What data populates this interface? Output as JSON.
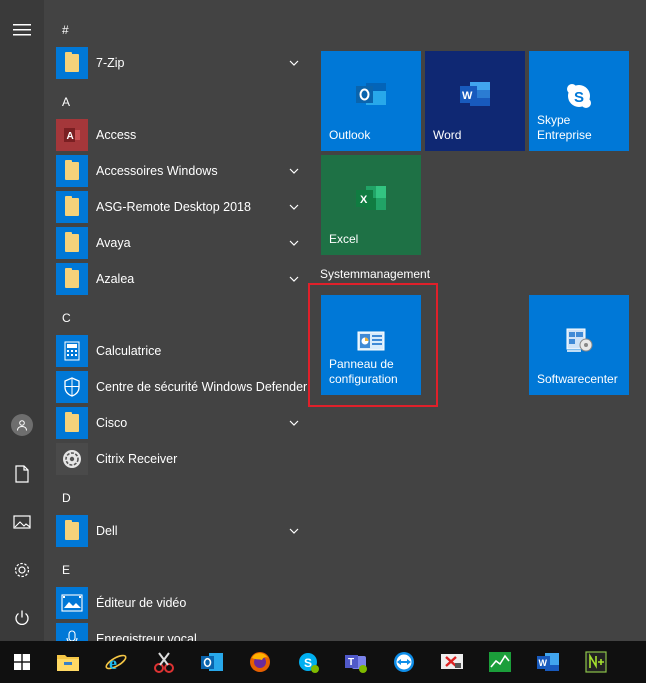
{
  "rail": {
    "menu_icon": "hamburger-icon",
    "user_icon": "user-icon",
    "documents_icon": "document-icon",
    "pictures_icon": "picture-icon",
    "settings_icon": "gear-icon",
    "power_icon": "power-icon"
  },
  "app_list": {
    "letters": [
      "#",
      "A",
      "C",
      "D",
      "E"
    ],
    "apps": [
      {
        "label": "7-Zip",
        "icon": "folder-icon",
        "expandable": true
      },
      {
        "label": "Access",
        "icon": "access-icon",
        "expandable": false
      },
      {
        "label": "Accessoires Windows",
        "icon": "folder-icon",
        "expandable": true
      },
      {
        "label": "ASG-Remote Desktop 2018",
        "icon": "folder-icon",
        "expandable": true
      },
      {
        "label": "Avaya",
        "icon": "folder-icon",
        "expandable": true
      },
      {
        "label": "Azalea",
        "icon": "folder-icon",
        "expandable": true
      },
      {
        "label": "Calculatrice",
        "icon": "calculator-icon",
        "expandable": false
      },
      {
        "label": "Centre de sécurité Windows Defender",
        "icon": "shield-icon",
        "expandable": false
      },
      {
        "label": "Cisco",
        "icon": "folder-icon",
        "expandable": true
      },
      {
        "label": "Citrix Receiver",
        "icon": "citrix-icon",
        "expandable": false
      },
      {
        "label": "Dell",
        "icon": "folder-icon",
        "expandable": true
      },
      {
        "label": "Éditeur de vidéo",
        "icon": "video-editor-icon",
        "expandable": false
      },
      {
        "label": "Enregistreur vocal",
        "icon": "microphone-icon",
        "expandable": false
      }
    ]
  },
  "tiles": {
    "outlook": "Outlook",
    "word": "Word",
    "skype": "Skype Entreprise",
    "excel": "Excel",
    "group_title": "Systemmanagement",
    "control_panel": "Panneau de configuration",
    "softwarecenter": "Softwarecenter"
  },
  "colors": {
    "tile_blue": "#0078d7",
    "excel_green": "#1e7145",
    "highlight_red": "#e0202a",
    "background": "#434343"
  },
  "taskbar": {
    "items": [
      "windows-start-icon",
      "file-explorer-icon",
      "internet-explorer-icon",
      "snipping-tool-icon",
      "outlook-icon",
      "firefox-icon",
      "skype-icon",
      "teams-icon",
      "teamviewer-icon",
      "remote-desktop-icon",
      "monitor-icon",
      "word-icon",
      "notepad-plus-icon"
    ]
  }
}
